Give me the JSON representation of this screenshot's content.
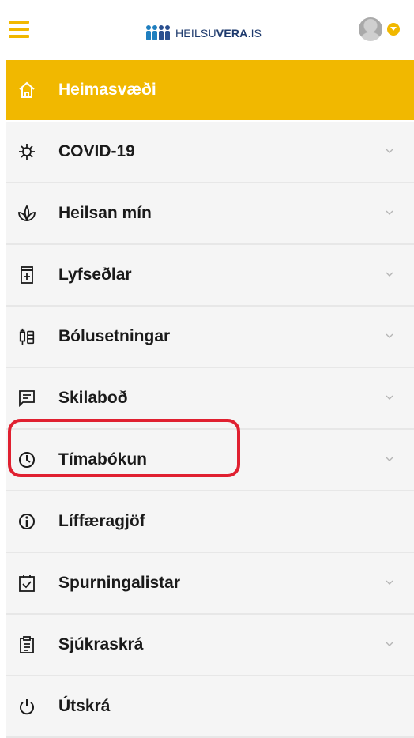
{
  "header": {
    "logo_regular": "HEILSU",
    "logo_bold": "VERA",
    "logo_suffix": ".IS"
  },
  "menu": {
    "items": [
      {
        "label": "Heimasvæði",
        "icon": "home-icon",
        "active": true
      },
      {
        "label": "COVID-19",
        "icon": "virus-icon",
        "expandable": true
      },
      {
        "label": "Heilsan mín",
        "icon": "plant-icon",
        "expandable": true
      },
      {
        "label": "Lyfseðlar",
        "icon": "medicine-icon",
        "expandable": true
      },
      {
        "label": "Bólusetningar",
        "icon": "syringe-icon",
        "expandable": true
      },
      {
        "label": "Skilaboð",
        "icon": "message-icon",
        "expandable": true
      },
      {
        "label": "Tímabókun",
        "icon": "clock-icon",
        "expandable": true,
        "highlighted": true
      },
      {
        "label": "Líffæragjöf",
        "icon": "organ-donor-icon",
        "expandable": false
      },
      {
        "label": "Spurningalistar",
        "icon": "checklist-icon",
        "expandable": true
      },
      {
        "label": "Sjúkraskrá",
        "icon": "clipboard-icon",
        "expandable": true
      },
      {
        "label": "Útskrá",
        "icon": "power-icon",
        "expandable": false
      }
    ]
  },
  "colors": {
    "accent": "#f1b800",
    "highlight_ring": "#e02030",
    "menu_bg": "#f5f5f5"
  }
}
